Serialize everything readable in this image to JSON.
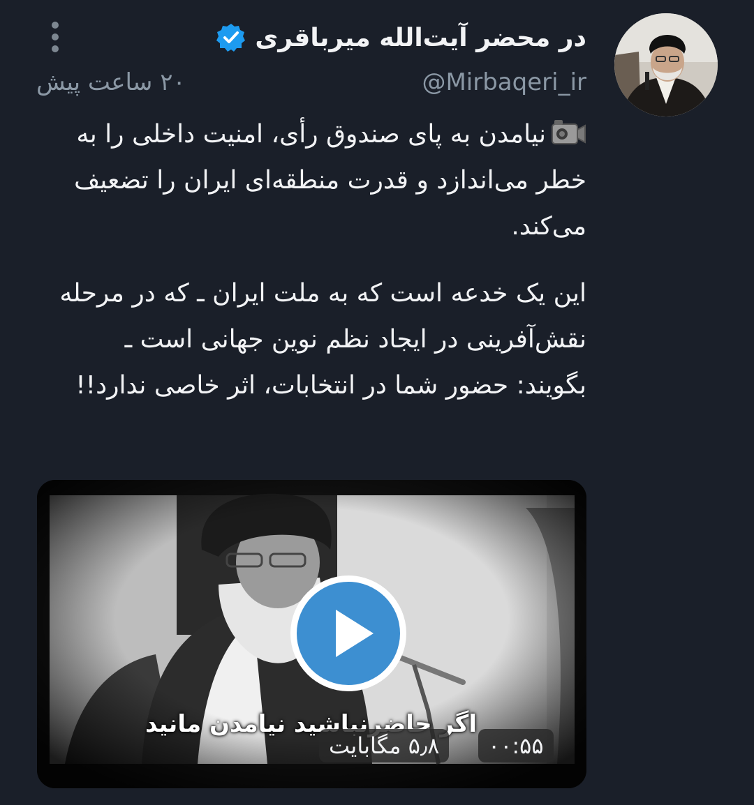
{
  "author": {
    "display_name": "در محضر آیت‌الله میرباقری",
    "handle": "@Mirbaqeri_ir",
    "verified": true
  },
  "tweet": {
    "time": "۲۰ ساعت پیش",
    "camera_icon": "video-camera-icon",
    "paragraph1": "نیامدن به پای صندوق رأی، امنیت داخلی را به خطر می‌اندازد و قدرت منطقه‌ای ایران را تضعیف می‌کند.",
    "paragraph2": "این یک خدعه است که به ملت ایران ـ که در مرحله نقش‌آفرینی در ایجاد نظم نوین جهانی است ـ بگویند: حضور شما در انتخابات، اثر خاصی ندارد!!"
  },
  "media": {
    "caption": "اگر حاضرنباشید نیامدن مانید",
    "size": "۵٫۸ مگابایت",
    "duration": "۰۰:۵۵",
    "play_icon": "play-icon"
  },
  "colors": {
    "background": "#1a1f29",
    "text": "#f2f3f5",
    "muted": "#8b98a5",
    "verified": "#1d9bf0",
    "play": "#3d8fd1"
  }
}
